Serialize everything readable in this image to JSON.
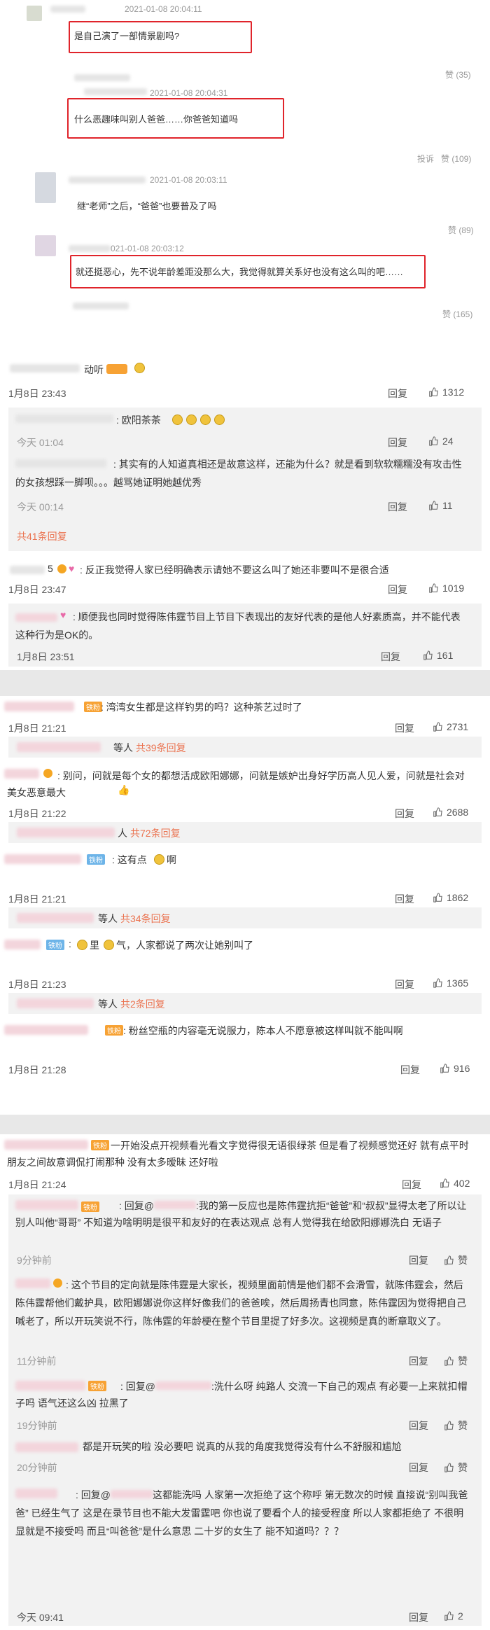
{
  "s1": {
    "c1": {
      "time": "2021-01-08 20:04:11",
      "text": "是自己演了一部情景剧吗?",
      "likes": "赞 (35)"
    },
    "c2": {
      "time": "2021-01-08 20:04:31",
      "text": "什么恶趣味叫别人爸爸……你爸爸知道吗",
      "report": "投诉",
      "likes": "赞 (109)"
    },
    "c3": {
      "time": "2021-01-08 20:03:11",
      "text": "继“老师”之后，“爸爸”也要普及了吗",
      "likes": "赞 (89)"
    },
    "c4": {
      "time": "2021-01-08 20:03:12",
      "time_prefix": "021-01-08 20:03:12",
      "text": "就还挺恶心，先不说年龄差距没那么大，我觉得就算关系好也没有这么叫的吧……",
      "likes": "赞 (165)"
    }
  },
  "s2": {
    "c1": {
      "name_tail": "动听",
      "time": "1月8日 23:43",
      "reply": "回复",
      "likes": "1312"
    },
    "r1": {
      "text": ": 欧阳茶茶",
      "time": "今天 01:04",
      "reply": "回复",
      "likes": "24"
    },
    "r2": {
      "text": ": 其实有的人知道真相还是故意这样，还能为什么？就是看到软软糯糯没有攻击性的女孩想踩一脚呗。。。越骂她证明她越优秀",
      "time": "今天 00:14",
      "reply": "回复",
      "likes": "11"
    },
    "more": "共41条回复",
    "c2": {
      "name_tail": "5",
      "text": ": 反正我觉得人家已经明确表示请她不要这么叫了她还非要叫不是很合适",
      "time": "1月8日 23:47",
      "reply": "回复",
      "likes": "1019"
    },
    "r3": {
      "text": ": 顺便我也同时觉得陈伟霆节目上节目下表现出的友好代表的是他人好素质高，并不能代表这种行为是OK的。",
      "time": "1月8日 23:51",
      "reply": "回复",
      "likes": "161"
    }
  },
  "s3": {
    "fan_badge": "铁粉",
    "c1": {
      "text": ": 湾湾女生都是这样钓男的吗？这种茶艺过时了",
      "time": "1月8日 21:21",
      "reply": "回复",
      "likes": "2731",
      "more_prefix": "等人",
      "more": "共39条回复"
    },
    "c2": {
      "text": ": 别问，问就是每个女的都想活成欧阳娜娜，问就是嫉妒出身好学历高人见人爱，问就是社会对美女恶意最大",
      "time": "1月8日 21:22",
      "reply": "回复",
      "likes": "2688",
      "more_prefix": "人",
      "more": "共72条回复"
    },
    "c3": {
      "text": ": 这有点",
      "text_end": "啊",
      "time": "1月8日 21:21",
      "reply": "回复",
      "likes": "1862",
      "more_prefix": "等人",
      "more": "共34条回复"
    },
    "c4": {
      "text_a": ": ",
      "text_b": "里",
      "text_c": "气，人家都说了两次让她别叫了",
      "time": "1月8日 21:23",
      "reply": "回复",
      "likes": "1365",
      "more_prefix": "等人",
      "more": "共2条回复"
    },
    "c5": {
      "text": ": 粉丝空瓶的内容毫无说服力，陈本人不愿意被这样叫就不能叫啊",
      "time": "1月8日 21:28",
      "reply": "回复",
      "likes": "916"
    }
  },
  "s4": {
    "c1": {
      "text": "一开始没点开视频看光看文字觉得很无语很绿茶 但是看了视频感觉还好 就有点平时朋友之间故意调侃打闹那种 没有太多暧昧 还好啦",
      "time": "1月8日 21:24",
      "reply": "回复",
      "likes": "402"
    },
    "r1": {
      "text": ": 回复@",
      "text2": ":我的第一反应也是陈伟霆抗拒“爸爸”和“叔叔”显得太老了所以让别人叫他“哥哥” 不知道为啥明明是很平和友好的在表达观点 总有人觉得我在给欧阳娜娜洗白 无语子",
      "time": "9分钟前",
      "reply": "回复",
      "like": "赞"
    },
    "r2": {
      "text": ": 这个节目的定向就是陈伟霆是大家长，视频里面前情是他们都不会滑雪，就陈伟霆会，然后陈伟霆帮他们戴护具，欧阳娜娜说你这样好像我们的爸爸唉，然后周扬青也同意，陈伟霆因为觉得把自己喊老了，所以开玩笑说不行，陈伟霆的年龄梗在整个节目里提了好多次。这视频是真的断章取义了。",
      "time": "11分钟前",
      "reply": "回复",
      "like": "赞"
    },
    "r3": {
      "text": ": 回复@",
      "text2": ":洗什么呀 纯路人 交流一下自己的观点 有必要一上来就扣帽子吗 语气还这么凶 拉黑了",
      "time": "19分钟前",
      "reply": "回复",
      "like": "赞"
    },
    "r4": {
      "text": "都是开玩笑的啦 没必要吧 说真的从我的角度我觉得没有什么不舒服和尴尬",
      "time": "20分钟前",
      "reply": "回复",
      "like": "赞"
    },
    "r5": {
      "text": ": 回复@",
      "text2": "这都能洗吗 人家第一次拒绝了这个称呼 第无数次的时候 直接说“别叫我爸爸” 已经生气了 这是在录节目也不能大发雷霆吧 你也说了要看个人的接受程度 所以人家都拒绝了 不很明显就是不接受吗 而且“叫爸爸”是什么意思 二十岁的女生了 能不知道吗？？？",
      "time": "今天 09:41",
      "reply": "回复",
      "likes": "2"
    }
  }
}
